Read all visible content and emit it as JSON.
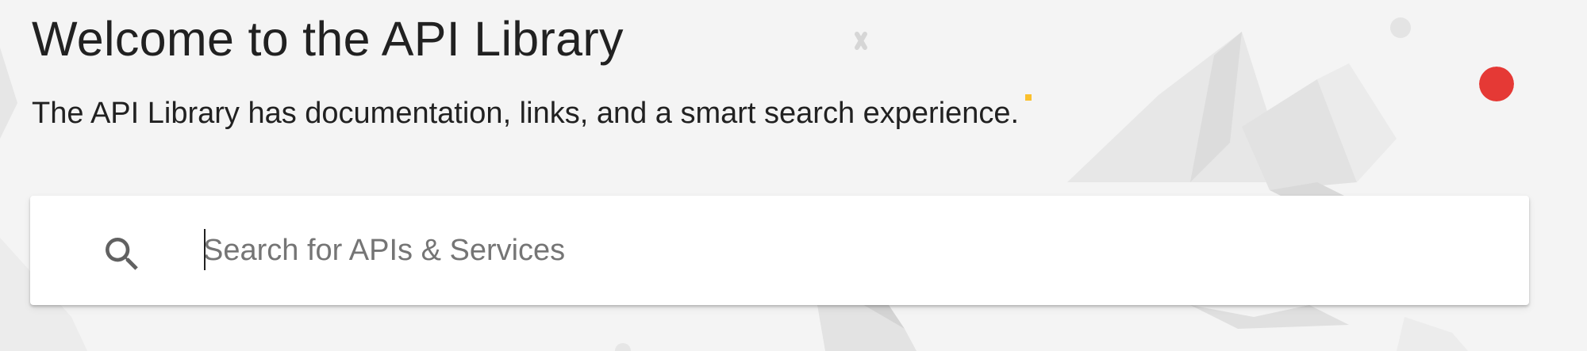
{
  "hero": {
    "title": "Welcome to the API Library",
    "subtitle": "The API Library has documentation, links, and a smart search experience."
  },
  "search": {
    "placeholder": "Search for APIs & Services",
    "value": "",
    "icon": "search-icon"
  },
  "colors": {
    "background": "#f4f4f4",
    "accent_red": "#e53935",
    "accent_yellow": "#fbc02d",
    "text_primary": "#212121",
    "text_placeholder": "#757575"
  }
}
